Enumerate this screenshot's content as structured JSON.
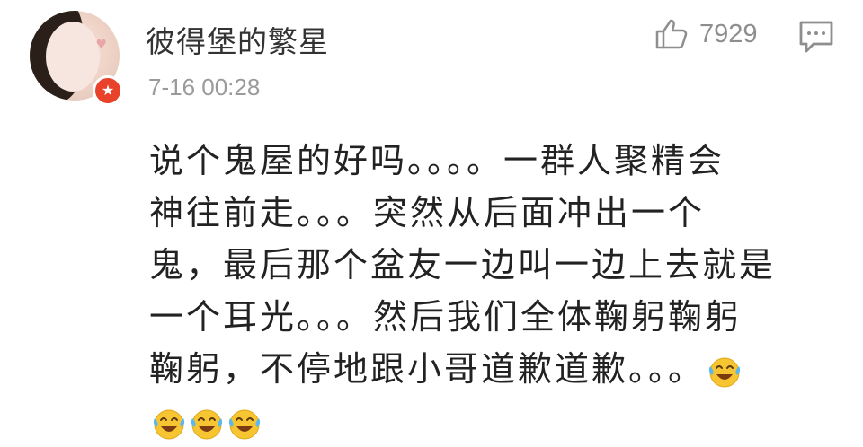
{
  "user": {
    "name": "彼得堡的繁星",
    "avatar_icon": "avatar-portrait",
    "badge_icon": "star-badge-icon",
    "badge_color": "#e8432a"
  },
  "post": {
    "time": "7-16 00:28",
    "likes": "7929",
    "lines": [
      "说个鬼屋的好吗。。。。一群人聚精会",
      "神往前走。。。突然从后面冲出一个",
      "鬼，最后那个盆友一边叫一边上去就是",
      "一个耳光。。。然后我们全体鞠躬鞠躬",
      "鞠躬，不停地跟小哥道歉道歉。。。"
    ],
    "emoji_icon": "laughing-crying-emoji",
    "trailing_emoji_count": 3
  },
  "actions": {
    "like_icon": "thumbs-up-icon",
    "comment_icon": "comment-icon"
  },
  "colors": {
    "name": "#333333",
    "time": "#9a9a9a",
    "body": "#222222",
    "icon": "#8e8e8e"
  }
}
